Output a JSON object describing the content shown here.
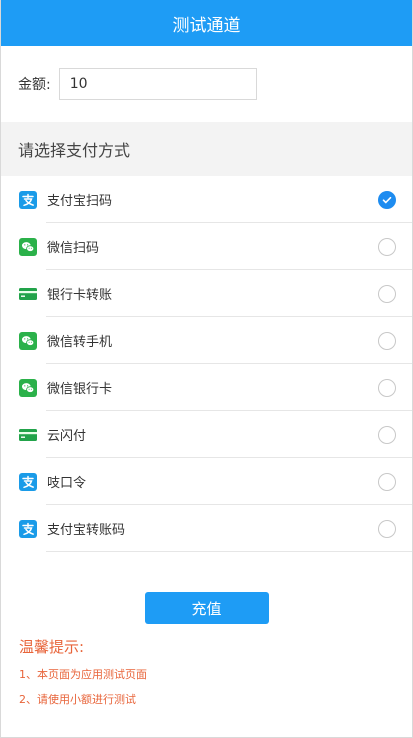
{
  "header": {
    "title": "测试通道"
  },
  "amount": {
    "label": "金额:",
    "value": "10"
  },
  "section": {
    "title": "请选择支付方式"
  },
  "payment_methods": [
    {
      "label": "支付宝扫码",
      "icon": "alipay-icon",
      "checked": true
    },
    {
      "label": "微信扫码",
      "icon": "wechat-icon",
      "checked": false
    },
    {
      "label": "银行卡转账",
      "icon": "bank-card-icon",
      "checked": false
    },
    {
      "label": "微信转手机",
      "icon": "wechat-icon",
      "checked": false
    },
    {
      "label": "微信银行卡",
      "icon": "wechat-icon",
      "checked": false
    },
    {
      "label": "云闪付",
      "icon": "bank-card-icon",
      "checked": false
    },
    {
      "label": "吱口令",
      "icon": "alipay-icon",
      "checked": false
    },
    {
      "label": "支付宝转账码",
      "icon": "alipay-icon",
      "checked": false
    }
  ],
  "button": {
    "label": "充值"
  },
  "tips": {
    "title": "温馨提示:",
    "lines": [
      "1、本页面为应用测试页面",
      "2、请使用小额进行测试"
    ]
  },
  "colors": {
    "primary": "#1e9cf5",
    "check": "#1e8cf0",
    "alipay": "#1a9be8",
    "wechat": "#2bb14a",
    "bank": "#22a34a",
    "tips": "#e8643a"
  }
}
